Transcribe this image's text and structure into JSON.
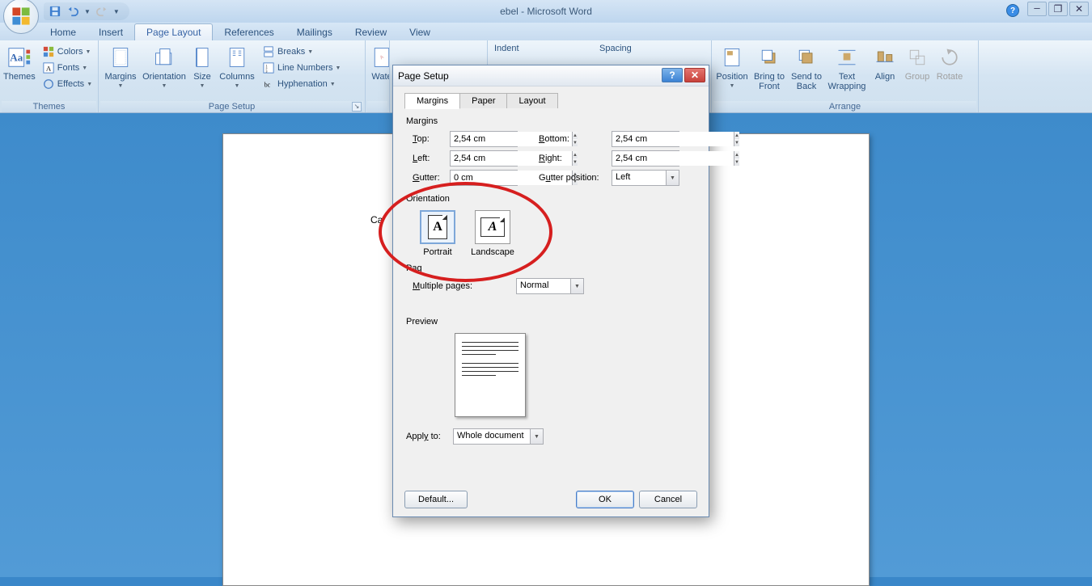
{
  "window": {
    "title": "ebel - Microsoft Word"
  },
  "menu": {
    "tabs": [
      "Home",
      "Insert",
      "Page Layout",
      "References",
      "Mailings",
      "Review",
      "View"
    ],
    "active": "Page Layout"
  },
  "ribbon": {
    "themes": {
      "group": "Themes",
      "main": "Themes",
      "colors": "Colors",
      "fonts": "Fonts",
      "effects": "Effects"
    },
    "pagesetup": {
      "group": "Page Setup",
      "margins": "Margins",
      "orientation": "Orientation",
      "size": "Size",
      "columns": "Columns",
      "breaks": "Breaks",
      "linenumbers": "Line Numbers",
      "hyphenation": "Hyphenation"
    },
    "pagebg": {
      "water": "Wate"
    },
    "para": {
      "indent": "Indent",
      "spacing": "Spacing"
    },
    "arrange": {
      "group": "Arrange",
      "position": "Position",
      "bringfront": "Bring to\nFront",
      "sendback": "Send to\nBack",
      "textwrap": "Text\nWrapping",
      "align": "Align",
      "groupbtn": "Group",
      "rotate": "Rotate"
    }
  },
  "doc": {
    "calloutText": "Ca"
  },
  "dialog": {
    "title": "Page Setup",
    "tabs": [
      "Margins",
      "Paper",
      "Layout"
    ],
    "activeTab": "Margins",
    "marginsSection": "Margins",
    "top": {
      "label": "Top:",
      "value": "2,54 cm"
    },
    "bottom": {
      "label": "Bottom:",
      "value": "2,54 cm"
    },
    "left": {
      "label": "Left:",
      "value": "2,54 cm"
    },
    "right": {
      "label": "Right:",
      "value": "2,54 cm"
    },
    "gutter": {
      "label": "Gutter:",
      "value": "0 cm"
    },
    "gutterpos": {
      "label": "Gutter position:",
      "value": "Left"
    },
    "orientationSection": "Orientation",
    "portrait": "Portrait",
    "landscape": "Landscape",
    "pagesSection": "Pag",
    "multiplePages": {
      "label": "Multiple pages:",
      "value": "Normal"
    },
    "previewSection": "Preview",
    "applyTo": {
      "label": "Apply to:",
      "value": "Whole document"
    },
    "defaultBtn": "Default...",
    "okBtn": "OK",
    "cancelBtn": "Cancel"
  }
}
